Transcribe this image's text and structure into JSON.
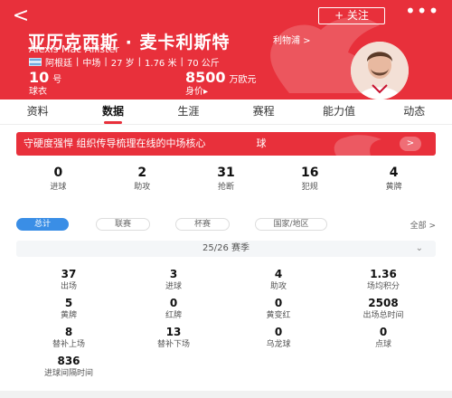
{
  "header": {
    "back_glyph": "<",
    "follow_label": "+ 关注",
    "more_glyph": "•••",
    "name_cn": "亚历克西斯 · 麦卡利斯特",
    "name_en": "Alexis Mac Allister",
    "club_link": "利物浦 >",
    "nationality": "阿根廷",
    "position": "中场",
    "age": "27 岁",
    "height": "1.76 米",
    "weight": "70 公斤",
    "shirt_number": "10",
    "shirt_number_unit": "号",
    "shirt_label": "球衣",
    "value": "8500",
    "value_unit": "万欧元",
    "value_label": "身价",
    "value_label_arrow": "▸",
    "brand_color": "#e8303b"
  },
  "tabs": [
    {
      "label": "资料"
    },
    {
      "label": "数据",
      "active": true
    },
    {
      "label": "生涯"
    },
    {
      "label": "赛程"
    },
    {
      "label": "能力值"
    },
    {
      "label": "动态"
    }
  ],
  "banner": {
    "text": "守硬度强悍 组织传导梳理在线的中场核心",
    "trail": "球",
    "button_glyph": ">"
  },
  "summary": [
    {
      "value": "0",
      "label": "进球"
    },
    {
      "value": "2",
      "label": "助攻"
    },
    {
      "value": "31",
      "label": "抢断"
    },
    {
      "value": "16",
      "label": "犯规"
    },
    {
      "value": "4",
      "label": "黄牌"
    }
  ],
  "filters": {
    "chips": [
      {
        "label": "总计",
        "active": true
      },
      {
        "label": "联赛"
      },
      {
        "label": "杯赛"
      },
      {
        "label": "国家/地区"
      }
    ],
    "all_label": "全部 >"
  },
  "season": {
    "label": "25/26 赛季",
    "caret": "⌄"
  },
  "stats": [
    [
      {
        "value": "37",
        "label": "出场"
      },
      {
        "value": "3",
        "label": "进球"
      },
      {
        "value": "4",
        "label": "助攻"
      },
      {
        "value": "1.36",
        "label": "场均积分"
      }
    ],
    [
      {
        "value": "5",
        "label": "黄牌"
      },
      {
        "value": "0",
        "label": "红牌"
      },
      {
        "value": "0",
        "label": "黄变红"
      },
      {
        "value": "2508",
        "label": "出场总时间"
      }
    ],
    [
      {
        "value": "8",
        "label": "替补上场"
      },
      {
        "value": "13",
        "label": "替补下场"
      },
      {
        "value": "0",
        "label": "乌龙球"
      },
      {
        "value": "0",
        "label": "点球"
      }
    ],
    [
      {
        "value": "836",
        "label": "进球间隔时间"
      }
    ]
  ]
}
